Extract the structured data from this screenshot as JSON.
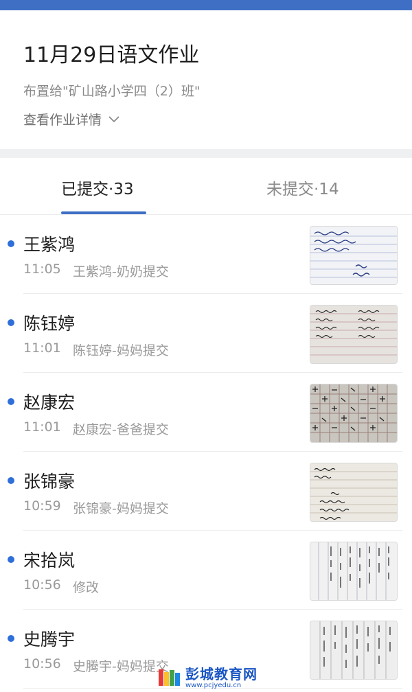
{
  "header": {
    "title": "11月29日语文作业",
    "assigned_to": "布置给\"矿山路小学四（2）班\"",
    "details_link": "查看作业详情"
  },
  "tabs": [
    {
      "label": "已提交·33",
      "active": true
    },
    {
      "label": "未提交·14",
      "active": false
    }
  ],
  "submissions": [
    {
      "name": "王紫鸿",
      "time": "11:05",
      "submitter": "王紫鸿-奶奶提交"
    },
    {
      "name": "陈钰婷",
      "time": "11:01",
      "submitter": "陈钰婷-妈妈提交"
    },
    {
      "name": "赵康宏",
      "time": "11:01",
      "submitter": "赵康宏-爸爸提交"
    },
    {
      "name": "张锦豪",
      "time": "10:59",
      "submitter": "张锦豪-妈妈提交"
    },
    {
      "name": "宋拾岚",
      "time": "10:56",
      "submitter": "修改"
    },
    {
      "name": "史腾宇",
      "time": "10:56",
      "submitter": "史腾宇-妈妈提交"
    }
  ],
  "watermark": {
    "text": "彭城教育网",
    "url": "www.pcjyedu.cn"
  },
  "colors": {
    "accent": "#3e6fc5",
    "unread_dot": "#2f6fd9",
    "secondary_text": "#9a9a9a"
  },
  "icons": {
    "details": "chevron-down-icon",
    "thumbnail": "homework-photo",
    "logo": "book-logo-icon"
  }
}
